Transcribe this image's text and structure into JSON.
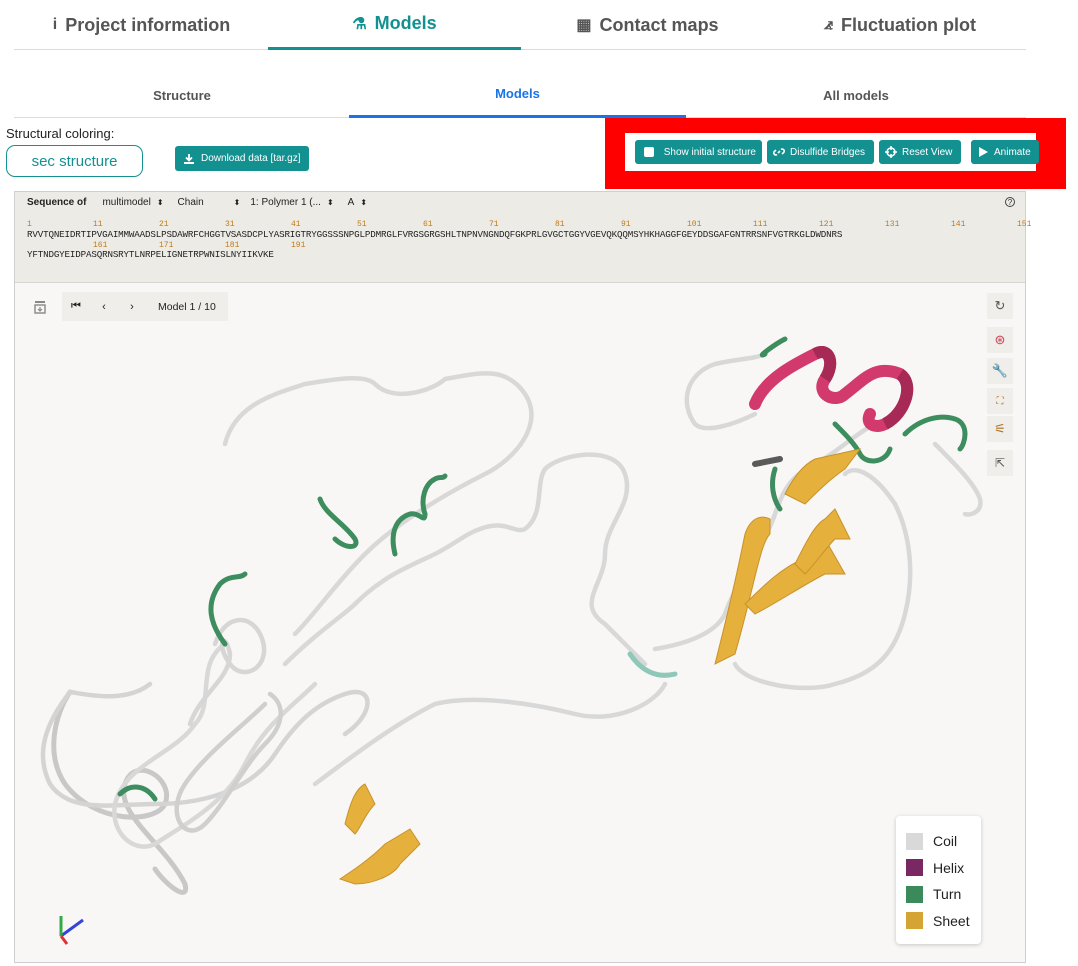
{
  "top_tabs": [
    {
      "label": "Project information",
      "icon": "info-icon",
      "glyph": "i"
    },
    {
      "label": "Models",
      "icon": "flask-icon",
      "glyph": "⚗"
    },
    {
      "label": "Contact maps",
      "icon": "grid-icon",
      "glyph": "▦"
    },
    {
      "label": "Fluctuation plot",
      "icon": "chart-icon",
      "glyph": "⦨"
    }
  ],
  "sub_tabs": [
    "Structure",
    "Models",
    "All models"
  ],
  "coloring": {
    "label": "Structural coloring:",
    "value": "sec structure"
  },
  "download_label": "Download data [tar.gz]",
  "toolbar": {
    "initial": "Show initial structure",
    "disulfide": "Disulfide Bridges",
    "reset": "Reset View",
    "animate": "Animate"
  },
  "sequence": {
    "label": "Sequence of",
    "selectors": [
      "multimodel",
      "Chain",
      "1: Polymer 1 (...",
      "A"
    ],
    "help": "?",
    "numbers_line1": [
      {
        "n": "1",
        "col": 0
      },
      {
        "n": "11",
        "col": 10
      },
      {
        "n": "21",
        "col": 20
      },
      {
        "n": "31",
        "col": 30
      },
      {
        "n": "41",
        "col": 40
      },
      {
        "n": "51",
        "col": 50
      },
      {
        "n": "61",
        "col": 60
      },
      {
        "n": "71",
        "col": 70
      },
      {
        "n": "81",
        "col": 80
      },
      {
        "n": "91",
        "col": 90
      },
      {
        "n": "101",
        "col": 100
      },
      {
        "n": "111",
        "col": 110
      },
      {
        "n": "121",
        "col": 120
      },
      {
        "n": "131",
        "col": 130
      },
      {
        "n": "141",
        "col": 140
      },
      {
        "n": "151",
        "col": 150
      }
    ],
    "line1": "RVVTQNEIDRTIPVGAIMMWAADSLPSDAWRFCHGGTVSASDCPLYASRIGTRYGGSSSNPGLPDMRGLFVRGSGRGSHLTNPNVNGNDQFGKPRLGVGCTGGYVGEVQKQQMSYHKHAGGFGEYDDSGAFGNTRRSNFVGTRKGLDWDNRS",
    "numbers_line2": [
      {
        "n": "161",
        "col": 10
      },
      {
        "n": "171",
        "col": 20
      },
      {
        "n": "181",
        "col": 30
      },
      {
        "n": "191",
        "col": 40
      }
    ],
    "line2": "YFTNDGYEIDPASQRNSRYTLNRPELIGNETRPWNISLNYIIKVKE"
  },
  "model_nav": {
    "first": "⏮",
    "prev": "‹",
    "next": "›",
    "label": "Model 1 / 10"
  },
  "legend": [
    {
      "label": "Coil",
      "color": "#d9d9d9"
    },
    {
      "label": "Helix",
      "color": "#7a2863"
    },
    {
      "label": "Turn",
      "color": "#3a8a5c"
    },
    {
      "label": "Sheet",
      "color": "#d4a535"
    }
  ],
  "colors": {
    "accent": "#139191",
    "active_sub": "#1a73e8",
    "highlight_box": "#ff0000",
    "helix_render": "#d23a6e",
    "sheet_render": "#e5b03b",
    "turn_render": "#3d8d5e",
    "coil_render": "#d8d8d8"
  }
}
